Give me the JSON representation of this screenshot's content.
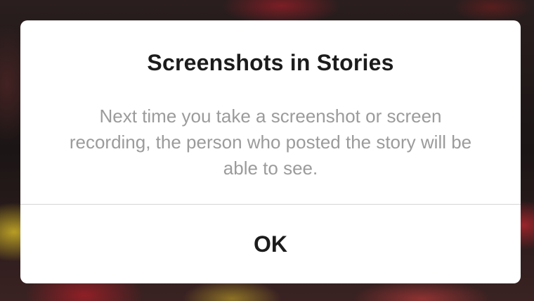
{
  "dialog": {
    "title": "Screenshots in Stories",
    "message": "Next time you take a screenshot or screen recording, the person who posted the story will be able to see.",
    "ok_label": "OK"
  },
  "colors": {
    "dialog_background": "#ffffff",
    "title_text": "#1c1c1c",
    "message_text": "#9b9b9b",
    "divider": "#d5d5d5"
  }
}
